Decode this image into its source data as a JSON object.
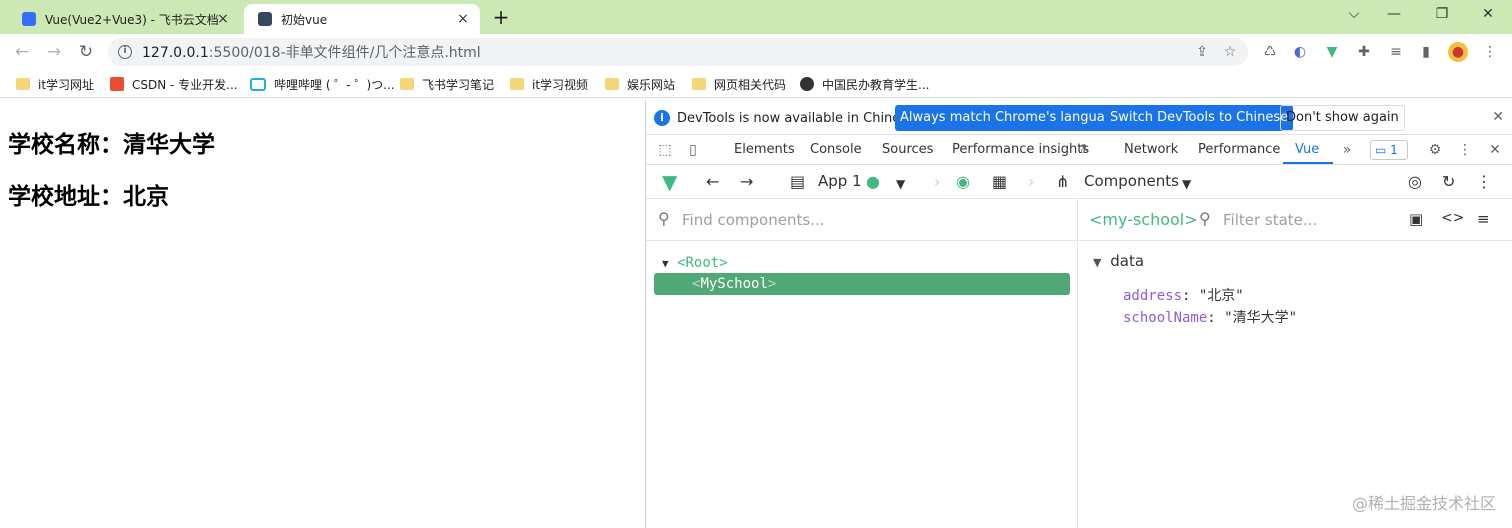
{
  "browser": {
    "tabs": [
      {
        "title": "Vue(Vue2+Vue3) - 飞书云文档",
        "active": false
      },
      {
        "title": "初始vue",
        "active": true
      }
    ],
    "url": {
      "host": "127.0.0.1",
      "path": ":5500/018-非单文件组件/几个注意点.html"
    },
    "bookmarks": [
      {
        "label": "it学习网址",
        "icon": "folder-icon"
      },
      {
        "label": "CSDN - 专业开发...",
        "icon": "csdn-icon"
      },
      {
        "label": "哔哩哔哩 ( ゜- ゜)つ...",
        "icon": "bilibili-icon"
      },
      {
        "label": "飞书学习笔记",
        "icon": "folder-icon"
      },
      {
        "label": "it学习视频",
        "icon": "folder-icon"
      },
      {
        "label": "娱乐网站",
        "icon": "folder-icon"
      },
      {
        "label": "网页相关代码",
        "icon": "folder-icon"
      },
      {
        "label": "中国民办教育学生...",
        "icon": "globe-icon"
      }
    ]
  },
  "page": {
    "school_name_line": "学校名称：清华大学",
    "school_address_line": "学校地址：北京"
  },
  "devtools": {
    "infobar": {
      "message": "DevTools is now available in Chinese!",
      "btn_match": "Always match Chrome's language",
      "btn_switch": "Switch DevTools to Chinese",
      "btn_dismiss": "Don't show again"
    },
    "tabs": [
      "Elements",
      "Console",
      "Sources",
      "Performance insights",
      "Network",
      "Performance",
      "Vue"
    ],
    "active_tab": "Vue",
    "issues_count": "1",
    "vue": {
      "app_label": "App 1",
      "components_label": "Components",
      "find_placeholder": "Find components...",
      "tree": {
        "root": "<Root>",
        "child": "MySchool"
      },
      "selected_component": "<my-school>",
      "filter_placeholder": "Filter state...",
      "section": "data",
      "state": [
        {
          "key": "address",
          "value": "\"北京\""
        },
        {
          "key": "schoolName",
          "value": "\"清华大学\""
        }
      ]
    }
  },
  "watermark": "@稀土掘金技术社区",
  "colors": {
    "tabstrip": "#cce8b5",
    "vue_green": "#42b983",
    "selected_row": "#4fa876",
    "chrome_blue": "#1a73e8"
  }
}
